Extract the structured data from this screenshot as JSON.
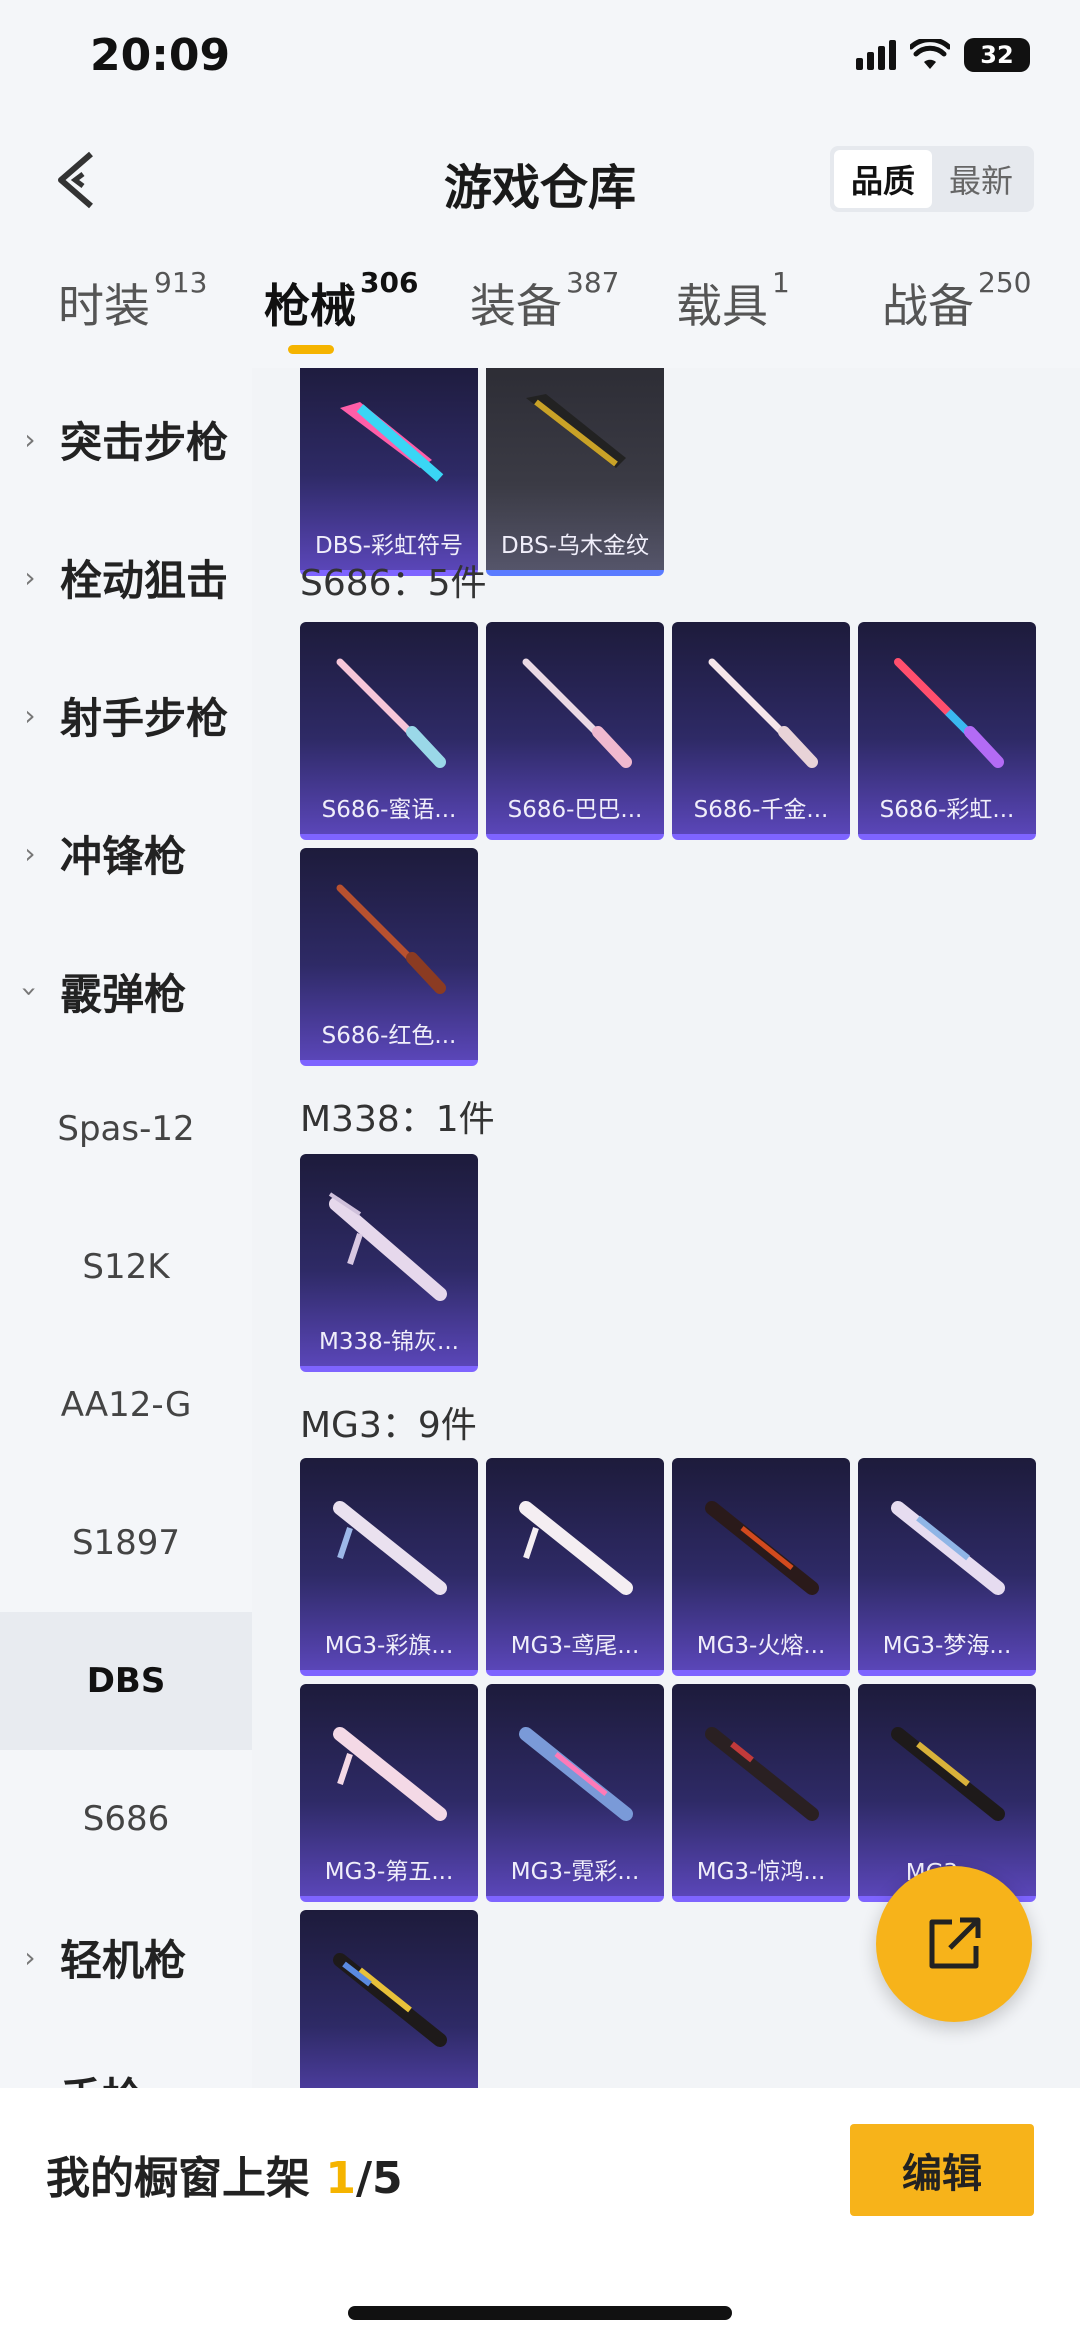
{
  "status_bar": {
    "time": "20:09",
    "battery": "32"
  },
  "header": {
    "title": "游戏仓库",
    "sort_options": [
      "品质",
      "最新"
    ]
  },
  "category_tabs": [
    {
      "label": "时装",
      "count": "913"
    },
    {
      "label": "枪械",
      "count": "306"
    },
    {
      "label": "装备",
      "count": "387"
    },
    {
      "label": "载具",
      "count": "1"
    },
    {
      "label": "战备",
      "count": "250"
    }
  ],
  "sidebar": {
    "categories": [
      "突击步枪",
      "栓动狙击",
      "射手步枪",
      "冲锋枪",
      "霰弹枪",
      "轻机枪",
      "手枪"
    ],
    "shotguns": [
      "Spas-12",
      "S12K",
      "AA12-G",
      "S1897",
      "DBS",
      "S686"
    ]
  },
  "content": {
    "dbs_items": [
      "DBS-彩虹符号",
      "DBS-乌木金纹"
    ],
    "s686": {
      "title": "S686：5件",
      "items": [
        "S686-蜜语...",
        "S686-巴巴...",
        "S686-千金...",
        "S686-彩虹...",
        "S686-红色..."
      ]
    },
    "m338": {
      "title": "M338：1件",
      "items": [
        "M338-锦灰..."
      ]
    },
    "mg3": {
      "title": "MG3：9件",
      "items": [
        "MG3-彩旗...",
        "MG3-鸢尾...",
        "MG3-火熔...",
        "MG3-梦海...",
        "MG3-第五...",
        "MG3-霓彩...",
        "MG3-惊鸿...",
        "MG3-...",
        ""
      ]
    }
  },
  "bottom_bar": {
    "label": "我的橱窗上架 ",
    "current": "1",
    "total": "/5",
    "edit_label": "编辑"
  },
  "colors": {
    "accent": "#f7b31a",
    "card_bottom": "#7e64ff"
  }
}
